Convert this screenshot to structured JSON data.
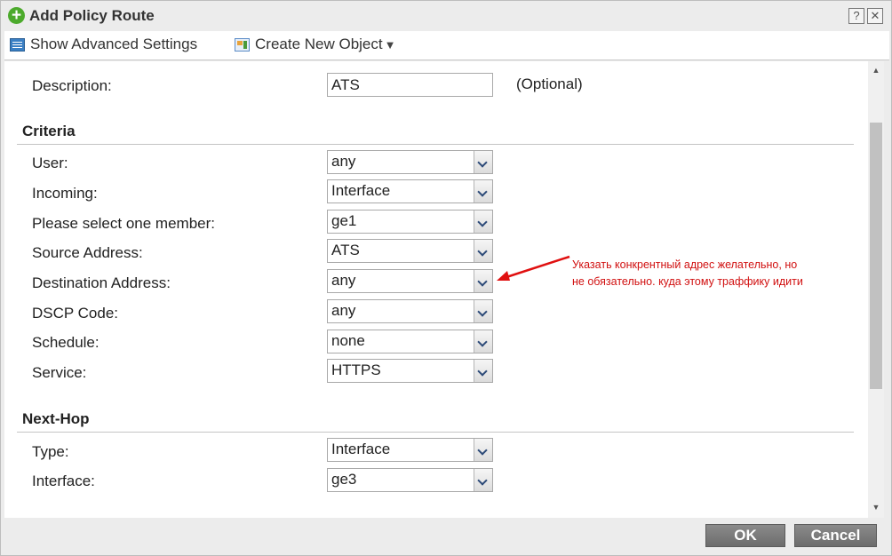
{
  "dialog": {
    "title": "Add Policy Route",
    "help_label": "?",
    "close_label": "✕"
  },
  "toolbar": {
    "advanced_label": "Show Advanced Settings",
    "create_object_label": "Create New Object",
    "caret": "▼"
  },
  "description": {
    "label": "Description:",
    "value": "ATS",
    "optional_label": "(Optional)"
  },
  "criteria": {
    "title": "Criteria",
    "fields": [
      {
        "label": "User:",
        "value": "any"
      },
      {
        "label": "Incoming:",
        "value": "Interface"
      },
      {
        "label": "Please select one member:",
        "value": "ge1"
      },
      {
        "label": "Source Address:",
        "value": "ATS"
      },
      {
        "label": "Destination Address:",
        "value": "any"
      },
      {
        "label": "DSCP Code:",
        "value": "any"
      },
      {
        "label": "Schedule:",
        "value": "none"
      },
      {
        "label": "Service:",
        "value": "HTTPS"
      }
    ]
  },
  "next_hop": {
    "title": "Next-Hop",
    "fields": [
      {
        "label": "Type:",
        "value": "Interface"
      },
      {
        "label": "Interface:",
        "value": "ge3"
      }
    ]
  },
  "annotation": {
    "line1": "Указать конкрентный адрес желательно, но",
    "line2": "не обязательно. куда этому траффику идити",
    "color": "#d11010"
  },
  "footer": {
    "ok_label": "OK",
    "cancel_label": "Cancel"
  },
  "colors": {
    "title_icon": "#4caa2c",
    "button": "#7a7a7a"
  }
}
